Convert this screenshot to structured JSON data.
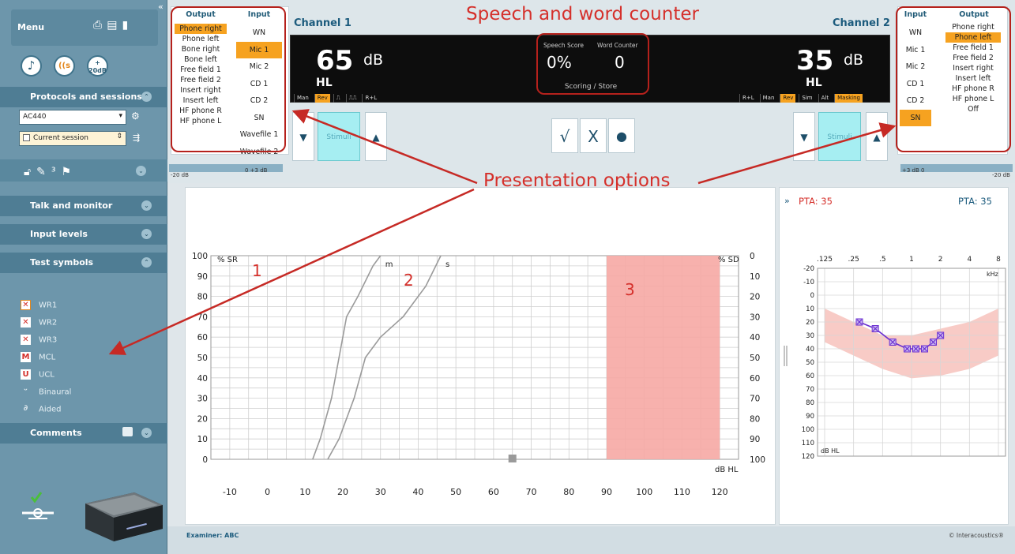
{
  "sidebar": {
    "menu_title": "Menu",
    "top_icons": [
      "print-icon",
      "save-icon",
      "exit-icon"
    ],
    "quick_buttons": [
      {
        "name": "music-note-icon",
        "glyph": "♪"
      },
      {
        "name": "speech-icon",
        "glyph": "((s"
      },
      {
        "name": "plus-20db-icon",
        "line1": "+",
        "line2": "20dB"
      }
    ],
    "protocols_label": "Protocols and sessions",
    "protocol_value": "AC440",
    "session_value": "Current session",
    "talk_label": "Talk and monitor",
    "input_levels_label": "Input levels",
    "test_symbols_label": "Test symbols",
    "test_symbols": [
      {
        "sym": "✕",
        "label": "WR1"
      },
      {
        "sym": "✕",
        "label": "WR2"
      },
      {
        "sym": "✕",
        "label": "WR3"
      },
      {
        "sym": "M",
        "label": "MCL"
      },
      {
        "sym": "U",
        "label": "UCL"
      },
      {
        "sym": "ᵕ",
        "label": "Binaural"
      },
      {
        "sym": "∂",
        "label": "Aided"
      }
    ],
    "comments_label": "Comments"
  },
  "left_box": {
    "output_head": "Output",
    "input_head": "Input",
    "outputs": [
      "Phone right",
      "Phone left",
      "Bone right",
      "Bone left",
      "Free field 1",
      "Free field 2",
      "Insert right",
      "Insert left",
      "HF phone R",
      "HF phone L"
    ],
    "output_selected": 0,
    "inputs": [
      "WN",
      "Mic 1",
      "Mic 2",
      "CD 1",
      "CD 2",
      "SN",
      "Wavefile 1",
      "Wavefile 2"
    ],
    "input_selected": 1
  },
  "right_box": {
    "input_head": "Input",
    "output_head": "Output",
    "inputs": [
      "WN",
      "Mic 1",
      "Mic 2",
      "CD 1",
      "CD 2",
      "SN"
    ],
    "input_selected": 5,
    "outputs": [
      "Phone right",
      "Phone left",
      "Free field 1",
      "Free field 2",
      "Insert right",
      "Insert left",
      "HF phone R",
      "HF phone L",
      "Off"
    ],
    "output_selected": 1
  },
  "channel1": {
    "title": "Channel 1",
    "db": "65",
    "unit": "dB",
    "hl": "HL",
    "modes": [
      "Man",
      "Rev",
      "⎍",
      "⎍⎍",
      "R+L"
    ],
    "mode_on": 1,
    "stimuli": "Stimuli",
    "level_left": "-20 dB",
    "level_mid": "0   +3 dB"
  },
  "channel2": {
    "title": "Channel 2",
    "db": "35",
    "unit": "dB",
    "hl": "HL",
    "modes": [
      "R+L",
      "Man",
      "Rev",
      "Sim",
      "Alt",
      "Masking"
    ],
    "modes_on": [
      2,
      5
    ],
    "stimuli": "Stimuli",
    "level_left": "+3 dB   0",
    "level_right": "-20 dB"
  },
  "center_display": {
    "speech_score_label": "Speech Score",
    "word_counter_label": "Word Counter",
    "speech_score": "0%",
    "word_counter": "0",
    "scoring_store": "Scoring  /  Store"
  },
  "score_buttons": {
    "correct": "√",
    "wrong": "X",
    "record": "●"
  },
  "annotations": {
    "title": "Speech and word counter",
    "presentation": "Presentation options",
    "marker1": "1",
    "marker2": "2",
    "marker3": "3"
  },
  "colors": {
    "accent_orange": "#f6a220",
    "annotation_red": "#d5302b",
    "shade": "#f6a9a4",
    "brand_blue": "#1c5b7d",
    "audiogram_line": "#6a2fd0"
  },
  "chart_data": [
    {
      "type": "line",
      "title": "",
      "xlabel": "dB HL",
      "ylabel": "% SR",
      "y2label": "% SD",
      "xlim": [
        -15,
        125
      ],
      "ylim": [
        0,
        100
      ],
      "xticks": [
        -10,
        0,
        10,
        20,
        30,
        40,
        50,
        60,
        70,
        80,
        90,
        100,
        110,
        120
      ],
      "yticks": [
        0,
        10,
        20,
        30,
        40,
        50,
        60,
        70,
        80,
        90,
        100
      ],
      "y2ticks": [
        100,
        90,
        80,
        70,
        60,
        50,
        40,
        30,
        20,
        10,
        0
      ],
      "series": [
        {
          "name": "m",
          "x": [
            12,
            14,
            17,
            19,
            21,
            24,
            28,
            30
          ],
          "y": [
            0,
            10,
            30,
            50,
            70,
            80,
            95,
            100
          ]
        },
        {
          "name": "s",
          "x": [
            16,
            19,
            23,
            26,
            30,
            36,
            42,
            46
          ],
          "y": [
            0,
            10,
            30,
            50,
            60,
            70,
            85,
            100
          ]
        }
      ],
      "shaded_region": {
        "x": [
          90,
          120
        ],
        "y": [
          0,
          100
        ]
      },
      "marker": {
        "x": 65,
        "y": 0
      }
    },
    {
      "type": "line",
      "title": "",
      "xlabel": "kHz",
      "ylabel": "dB HL",
      "xticks": [
        ".125",
        ".25",
        ".5",
        "1",
        "2",
        "4",
        "8"
      ],
      "yticks": [
        -20,
        -10,
        0,
        10,
        20,
        30,
        40,
        50,
        60,
        70,
        80,
        90,
        100,
        110,
        120
      ],
      "ylim": [
        -20,
        120
      ],
      "pta_left": "PTA:  35",
      "pta_right": "PTA:  35",
      "series": [
        {
          "name": "",
          "x_index": [
            1.2,
            1.75,
            2.35,
            2.85,
            3.15,
            3.45,
            3.75,
            4.0
          ],
          "y": [
            20,
            25,
            35,
            40,
            40,
            40,
            35,
            30
          ]
        }
      ],
      "banana": {
        "upper": [
          10,
          20,
          30,
          30,
          25,
          20,
          10
        ],
        "lower": [
          35,
          45,
          55,
          62,
          60,
          55,
          45
        ]
      }
    }
  ],
  "footer": {
    "examiner": "Examiner: ABC",
    "brand": "© Interacoustics®"
  }
}
